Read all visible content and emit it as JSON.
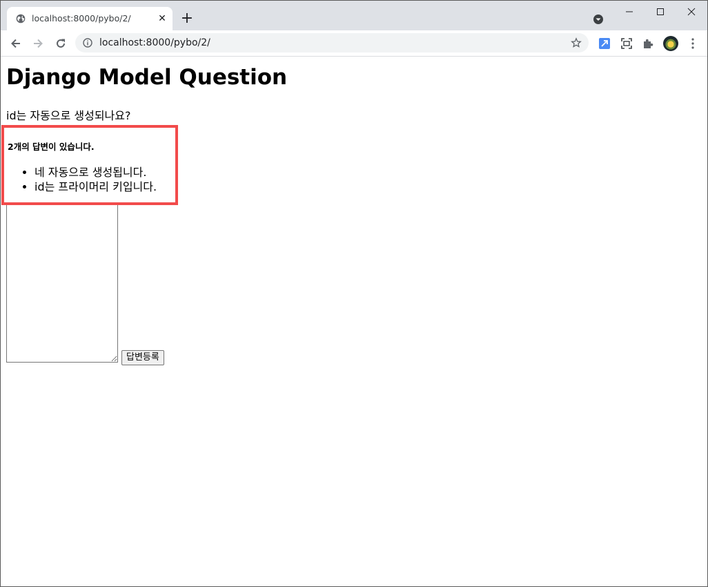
{
  "browser": {
    "tab_title": "localhost:8000/pybo/2/",
    "tab_close": "✕",
    "new_tab": "+",
    "url": "localhost:8000/pybo/2/"
  },
  "page": {
    "title": "Django Model Question",
    "question_content": "id는 자동으로 생성되나요?",
    "answer_count_text": "2개의 답변이 있습니다.",
    "answers": [
      "네 자동으로 생성됩니다.",
      "id는 프라이머리 키입니다."
    ],
    "textarea_value": "",
    "submit_label": "답변등록"
  },
  "colors": {
    "highlight_border": "#f24b4b",
    "tabstrip_bg": "#dee1e6"
  }
}
